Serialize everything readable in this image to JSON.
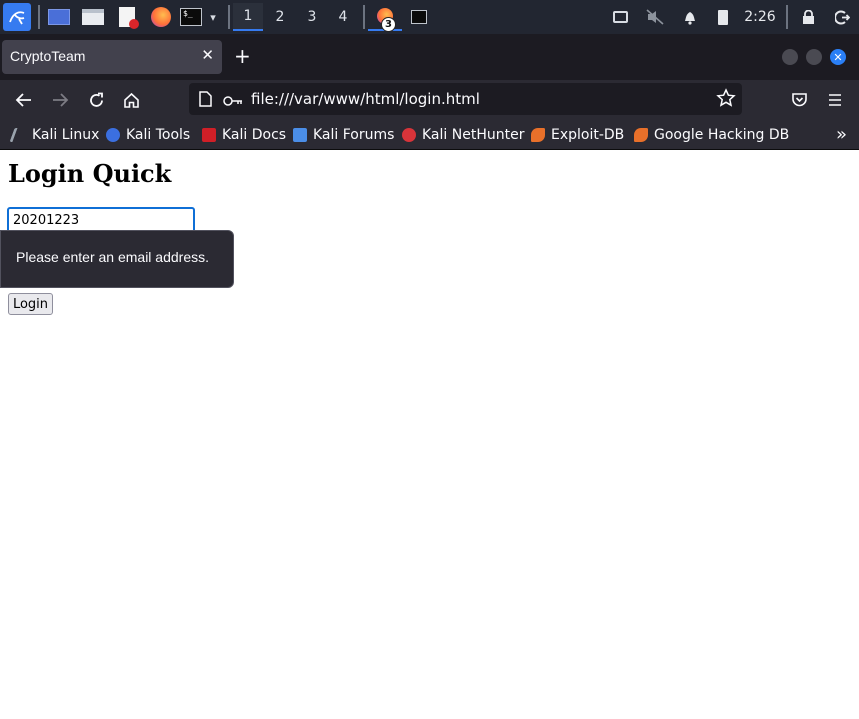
{
  "taskbar": {
    "workspaces": [
      "1",
      "2",
      "3",
      "4"
    ],
    "active_workspace": "1",
    "firefox_badge": "3",
    "clock": "2:26",
    "icons": [
      "kali-menu-icon",
      "desktop-icon",
      "files-icon",
      "editor-icon",
      "firefox-icon",
      "terminal-icon",
      "chevron-down-icon",
      "firefox-window-icon",
      "terminal-window-icon",
      "display-icon",
      "muted-volume-icon",
      "bell-icon",
      "battery-icon",
      "lock-icon",
      "logout-icon"
    ]
  },
  "browser": {
    "tab_title": "CryptoTeam",
    "url": "file:///var/www/html/login.html",
    "bookmarks": [
      "Kali Linux",
      "Kali Tools",
      "Kali Docs",
      "Kali Forums",
      "Kali NetHunter",
      "Exploit-DB",
      "Google Hacking DB"
    ]
  },
  "page": {
    "heading": "Login Quick",
    "email_value": "20201223",
    "validation_message": "Please enter an email address.",
    "login_label": "Login"
  },
  "colors": {
    "panel_bg": "#222631",
    "accent": "#367bf0",
    "toolbar_bg": "#2b2a33",
    "tabbar_bg": "#1c1b22",
    "focus_ring": "#0f6fd6"
  }
}
